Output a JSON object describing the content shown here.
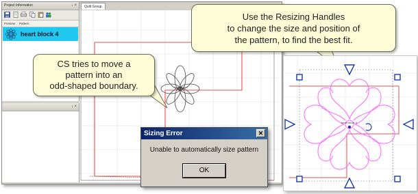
{
  "app": {
    "project_panel_title": "Project Information",
    "pin_glyph": "↓ ×",
    "columns": {
      "preview": "Preview",
      "pattern": "Pattern"
    },
    "pattern_name": "heart block 4",
    "tab_label": "Quilt Group",
    "pattern_label": "heart block 4",
    "toolbar_icons": [
      "save-icon",
      "open-icon",
      "print-icon",
      "copy-icon",
      "paste-icon",
      "people-icon"
    ]
  },
  "callouts": {
    "left": [
      "CS tries to move a",
      "pattern into an",
      "odd-shaped boundary."
    ],
    "right": [
      "Use the Resizing Handles",
      "to change the size and position of",
      "the pattern, to find the best fit."
    ]
  },
  "dialog": {
    "title": "Sizing Error",
    "close_glyph": "✕",
    "message": "Unable to automatically size pattern",
    "ok_label": "OK"
  },
  "handles_view": {
    "pattern_label": "heart block 4"
  },
  "colors": {
    "selected_row": "#1ec8ee",
    "boundary_red": "#e05050",
    "pattern_pink": "#ff66ff",
    "handle_blue": "#1a3aa8",
    "callout_fill": "#fdfcd7",
    "dialog_title": "#0a246a"
  }
}
